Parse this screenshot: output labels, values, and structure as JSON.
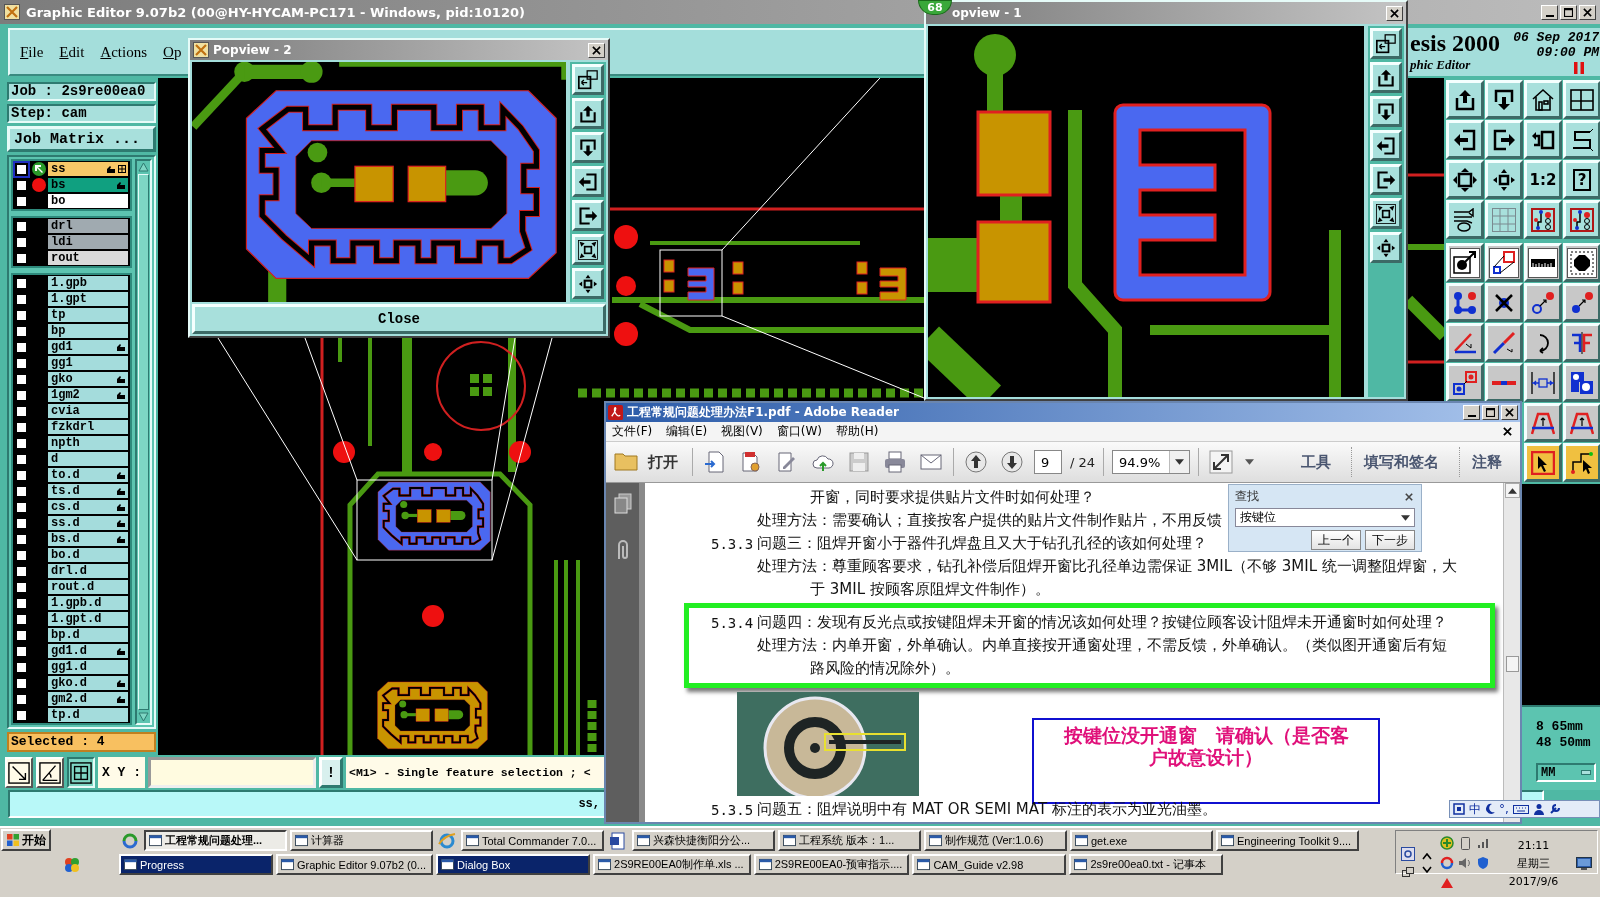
{
  "window": {
    "title": "Graphic Editor 9.07b2 (00@HY-HYCAM-PC171 - Windows, pid:10120)"
  },
  "menu": [
    {
      "label": "File"
    },
    {
      "label": "Edit"
    },
    {
      "label": "Actions"
    },
    {
      "label": "Op"
    }
  ],
  "header": {
    "product": "esis 2000",
    "date": "06 Sep 2017",
    "time": "09:00 PM",
    "subtitle": "phic Editor"
  },
  "job_panel": {
    "job": "Job : 2s9re00ea0",
    "step": "Step: cam",
    "matrix_button": "Job Matrix ...",
    "selected_count": "Selected : 4"
  },
  "layer_groups": [
    {
      "layers": [
        {
          "name": "ss",
          "color": "#f8c868",
          "checked": false,
          "work": true,
          "displayed": false,
          "affected": true
        },
        {
          "name": "bs",
          "color": "#10a080",
          "checked": false,
          "work": false,
          "displayed": true,
          "affected": true
        },
        {
          "name": "bo",
          "color": "#ffffff",
          "checked": false,
          "work": false,
          "displayed": false,
          "affected": false
        }
      ]
    },
    {
      "layers": [
        {
          "name": "drl",
          "color": "#a0aab0",
          "checked": false,
          "work": false,
          "displayed": false,
          "affected": false
        },
        {
          "name": "ldi",
          "color": "#a0aab0",
          "checked": false,
          "work": false,
          "displayed": false,
          "affected": false
        },
        {
          "name": "rout",
          "color": "#dadada",
          "checked": false,
          "work": false,
          "displayed": false,
          "affected": false
        }
      ]
    },
    {
      "layers": [
        {
          "name": "1.gpb",
          "color": "#a4dcdc",
          "checked": false,
          "work": false,
          "displayed": false,
          "affected": false
        },
        {
          "name": "1.gpt",
          "color": "#a4dcdc",
          "checked": false,
          "work": false,
          "displayed": false,
          "affected": false
        },
        {
          "name": "tp",
          "color": "#a4dcdc",
          "checked": false,
          "work": false,
          "displayed": false,
          "affected": false
        },
        {
          "name": "bp",
          "color": "#a4dcdc",
          "checked": false,
          "work": false,
          "displayed": false,
          "affected": false
        },
        {
          "name": "gd1",
          "color": "#a4dcdc",
          "checked": false,
          "work": false,
          "displayed": false,
          "affected": true
        },
        {
          "name": "gg1",
          "color": "#a4dcdc",
          "checked": false,
          "work": false,
          "displayed": false,
          "affected": false
        },
        {
          "name": "gko",
          "color": "#a4dcdc",
          "checked": false,
          "work": false,
          "displayed": false,
          "affected": true
        },
        {
          "name": "1gm2",
          "color": "#a4dcdc",
          "checked": false,
          "work": false,
          "displayed": false,
          "affected": true
        },
        {
          "name": "cvia",
          "color": "#a4dcdc",
          "checked": false,
          "work": false,
          "displayed": false,
          "affected": false
        },
        {
          "name": "fzkdrl",
          "color": "#a4dcdc",
          "checked": false,
          "work": false,
          "displayed": false,
          "affected": false
        },
        {
          "name": "npth",
          "color": "#a4dcdc",
          "checked": false,
          "work": false,
          "displayed": false,
          "affected": false
        },
        {
          "name": "d",
          "color": "#a4dcdc",
          "checked": false,
          "work": false,
          "displayed": false,
          "affected": false
        },
        {
          "name": "to.d",
          "color": "#a4dcdc",
          "checked": false,
          "work": false,
          "displayed": false,
          "affected": true
        },
        {
          "name": "ts.d",
          "color": "#a4dcdc",
          "checked": false,
          "work": false,
          "displayed": false,
          "affected": true
        },
        {
          "name": "cs.d",
          "color": "#a4dcdc",
          "checked": false,
          "work": false,
          "displayed": false,
          "affected": true
        },
        {
          "name": "ss.d",
          "color": "#a4dcdc",
          "checked": false,
          "work": false,
          "displayed": false,
          "affected": true
        },
        {
          "name": "bs.d",
          "color": "#a4dcdc",
          "checked": false,
          "work": false,
          "displayed": false,
          "affected": true
        },
        {
          "name": "bo.d",
          "color": "#a4dcdc",
          "checked": false,
          "work": false,
          "displayed": false,
          "affected": false
        },
        {
          "name": "drl.d",
          "color": "#a4dcdc",
          "checked": false,
          "work": false,
          "displayed": false,
          "affected": false
        },
        {
          "name": "rout.d",
          "color": "#a4dcdc",
          "checked": false,
          "work": false,
          "displayed": false,
          "affected": false
        },
        {
          "name": "1.gpb.d",
          "color": "#a4dcdc",
          "checked": false,
          "work": false,
          "displayed": false,
          "affected": false
        },
        {
          "name": "1.gpt.d",
          "color": "#a4dcdc",
          "checked": false,
          "work": false,
          "displayed": false,
          "affected": false
        },
        {
          "name": "bp.d",
          "color": "#a4dcdc",
          "checked": false,
          "work": false,
          "displayed": false,
          "affected": false
        },
        {
          "name": "gd1.d",
          "color": "#a4dcdc",
          "checked": false,
          "work": false,
          "displayed": false,
          "affected": true
        },
        {
          "name": "gg1.d",
          "color": "#a4dcdc",
          "checked": false,
          "work": false,
          "displayed": false,
          "affected": false
        },
        {
          "name": "gko.d",
          "color": "#a4dcdc",
          "checked": false,
          "work": false,
          "displayed": false,
          "affected": true
        },
        {
          "name": "gm2.d",
          "color": "#a4dcdc",
          "checked": false,
          "work": false,
          "displayed": false,
          "affected": true
        },
        {
          "name": "tp.d",
          "color": "#a4dcdc",
          "checked": false,
          "work": false,
          "displayed": false,
          "affected": false
        }
      ]
    }
  ],
  "view_toggles": [
    {
      "on": false
    },
    {
      "on": false
    },
    {
      "on": true
    }
  ],
  "coordinate_bar": {
    "label": "X Y :",
    "alert_button": "!",
    "message": "<M1> - Single feature selection ; <"
  },
  "status_line": "ss,",
  "tool_palette": {
    "ratio": "1:2",
    "help": "?"
  },
  "readouts": {
    "x": "8 65mm",
    "y": "48 50mm",
    "units": "MM"
  },
  "popview_2": {
    "title": "Popview - 2",
    "close_button": "Close"
  },
  "popview_1": {
    "title": "opview - 1",
    "badge": "68"
  },
  "reader": {
    "title": "工程常规问题处理办法F1.pdf - Adobe Reader",
    "menu": [
      "文件(F)",
      "编辑(E)",
      "视图(V)",
      "窗口(W)",
      "帮助(H)"
    ],
    "toolbar": {
      "open_button": "打开",
      "page": "9",
      "page_count": "/ 24",
      "zoom": "94.9%",
      "panes": [
        "工具",
        "填写和签名",
        "注释"
      ]
    },
    "find": {
      "title": "查找",
      "query": "按键位",
      "buttons": [
        "上一个",
        "下一步"
      ]
    },
    "document": {
      "before": [
        {
          "kind": "continuation",
          "text": "开窗，同时要求提供贴片文件时如何处理？"
        },
        {
          "kind": "answer",
          "text": "处理方法：需要确认；直接按客户提供的贴片文件制作贴片，不用反馈"
        },
        {
          "kind": "question",
          "number": "5.3.3",
          "text": "问题三：阻焊开窗小于器件孔焊盘且又大于钻孔孔径的该如何处理？"
        },
        {
          "kind": "answer",
          "text": "处理方法：尊重顾客要求，钻孔补偿后阻焊开窗比孔径单边需保证 3MIL（不够 3MIL 统一调整阻焊窗，大"
        },
        {
          "kind": "continuation",
          "text": "于 3MIL 按顾客原阻焊文件制作）。"
        }
      ],
      "highlighted": [
        {
          "kind": "question",
          "number": "5.3.4",
          "text": "问题四：发现有反光点或按键阻焊未开窗的情况该如何处理？按键位顾客设计阻焊未开通窗时如何处理？"
        },
        {
          "kind": "answer",
          "text": "处理方法：内单开窗，外单确认。内单直接按开通窗处理，不需反馈，外单确认。（类似图开通窗后有短"
        },
        {
          "kind": "continuation",
          "text": "路风险的情况除外）。"
        }
      ],
      "callout": "按键位没开通窗　请确认（是否客户故意设计）",
      "after": [
        {
          "kind": "question",
          "number": "5.3.5",
          "text": "问题五：阻焊说明中有 MAT OR SEMI MAT 标注的表示为亚光油墨。"
        }
      ]
    }
  },
  "ime_bar": {
    "mode": "中",
    "punctuation": "°,"
  },
  "taskbar": {
    "start_button": "开始",
    "upper_row": [
      {
        "kind": "launcher"
      },
      {
        "kind": "task",
        "label": "工程常规问题处理...",
        "selected": true,
        "flashing": false
      },
      {
        "kind": "task",
        "label": "计算器",
        "selected": false,
        "flashing": false
      },
      {
        "kind": "launcher"
      },
      {
        "kind": "task",
        "label": "Total Commander 7.0...",
        "selected": false,
        "flashing": false
      },
      {
        "kind": "launcher"
      },
      {
        "kind": "task",
        "label": "兴森快捷衡阳分公...",
        "selected": false,
        "flashing": false
      },
      {
        "kind": "task",
        "label": "工程系统  版本：1...",
        "selected": false,
        "flashing": false
      },
      {
        "kind": "task",
        "label": "制作规范 (Ver:1.0.6)",
        "selected": false,
        "flashing": false
      },
      {
        "kind": "task",
        "label": "get.exe",
        "selected": false,
        "flashing": false
      },
      {
        "kind": "task",
        "label": "Engineering Toolkit 9....",
        "selected": false,
        "flashing": false
      }
    ],
    "lower_row": [
      {
        "kind": "task",
        "label": "Progress",
        "selected": false,
        "flashing": true
      },
      {
        "kind": "task",
        "label": "Graphic Editor 9.07b2 (0...",
        "selected": false,
        "flashing": false
      },
      {
        "kind": "task",
        "label": "Dialog Box",
        "selected": false,
        "flashing": true
      },
      {
        "kind": "task",
        "label": "2S9RE00EA0制作单.xls ...",
        "selected": false,
        "flashing": false
      },
      {
        "kind": "task",
        "label": "2S9RE00EA0-预审指示....",
        "selected": false,
        "flashing": false
      },
      {
        "kind": "task",
        "label": "CAM_Guide v2.98",
        "selected": false,
        "flashing": false
      },
      {
        "kind": "task",
        "label": "2s9re00ea0.txt - 记事本",
        "selected": false,
        "flashing": false
      }
    ],
    "clock": {
      "time": "21:11",
      "day": "星期三",
      "date": "2017/9/6"
    }
  }
}
